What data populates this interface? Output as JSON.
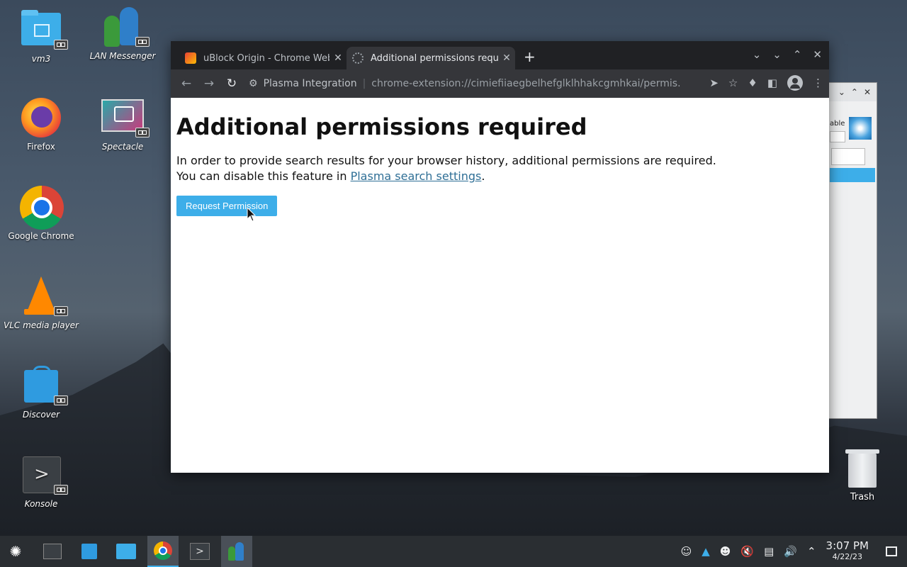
{
  "desktop": {
    "icons": [
      {
        "label": "vm3"
      },
      {
        "label": "LAN Messenger"
      },
      {
        "label": "Firefox"
      },
      {
        "label": "Spectacle"
      },
      {
        "label": "Google Chrome"
      },
      {
        "label": "VLC media player"
      },
      {
        "label": "Discover"
      },
      {
        "label": "Konsole"
      }
    ],
    "trash_label": "Trash"
  },
  "back_window": {
    "partial_text": "able"
  },
  "browser": {
    "tabs": [
      {
        "title": "uBlock Origin - Chrome Web Store"
      },
      {
        "title": "Additional permissions required"
      }
    ],
    "new_tab": "+",
    "omnibox": {
      "site": "Plasma Integration",
      "url": "chrome-extension://cimiefiiaegbelhefglklhhakcgmhkai/permis..."
    },
    "page": {
      "heading": "Additional permissions required",
      "line1": "In order to provide search results for your browser history, additional permissions are required.",
      "line2_prefix": "You can disable this feature in ",
      "link": "Plasma search settings",
      "line2_suffix": ".",
      "button": "Request Permission"
    }
  },
  "taskbar": {
    "time": "3:07 PM",
    "date": "4/22/23"
  },
  "colors": {
    "accent": "#3daee9",
    "tab_bar": "#202124",
    "toolbar": "#35363a"
  }
}
